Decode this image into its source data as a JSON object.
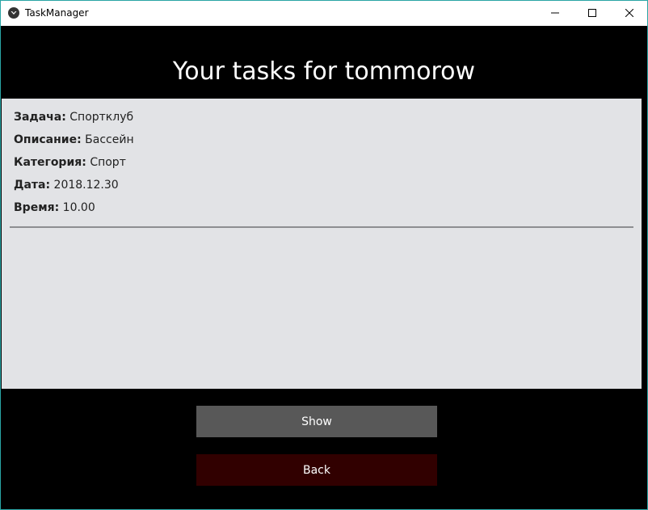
{
  "window": {
    "title": "TaskManager"
  },
  "header": {
    "title": "Your tasks for tommorow"
  },
  "task": {
    "fields": [
      {
        "label": "Задача:",
        "value": "Спортклуб"
      },
      {
        "label": "Описание:",
        "value": "Бассейн"
      },
      {
        "label": "Категория:",
        "value": "Спорт"
      },
      {
        "label": "Дата:",
        "value": "2018.12.30"
      },
      {
        "label": "Время:",
        "value": "10.00"
      }
    ]
  },
  "buttons": {
    "show_label": "Show",
    "back_label": "Back"
  },
  "colors": {
    "panel_bg": "#e2e3e6",
    "show_btn": "#585858",
    "back_btn": "#310000",
    "window_border": "#2aa5a5"
  },
  "icons": {
    "app": "kivy-logo-icon",
    "minimize": "minimize-icon",
    "maximize": "maximize-icon",
    "close": "close-icon"
  }
}
